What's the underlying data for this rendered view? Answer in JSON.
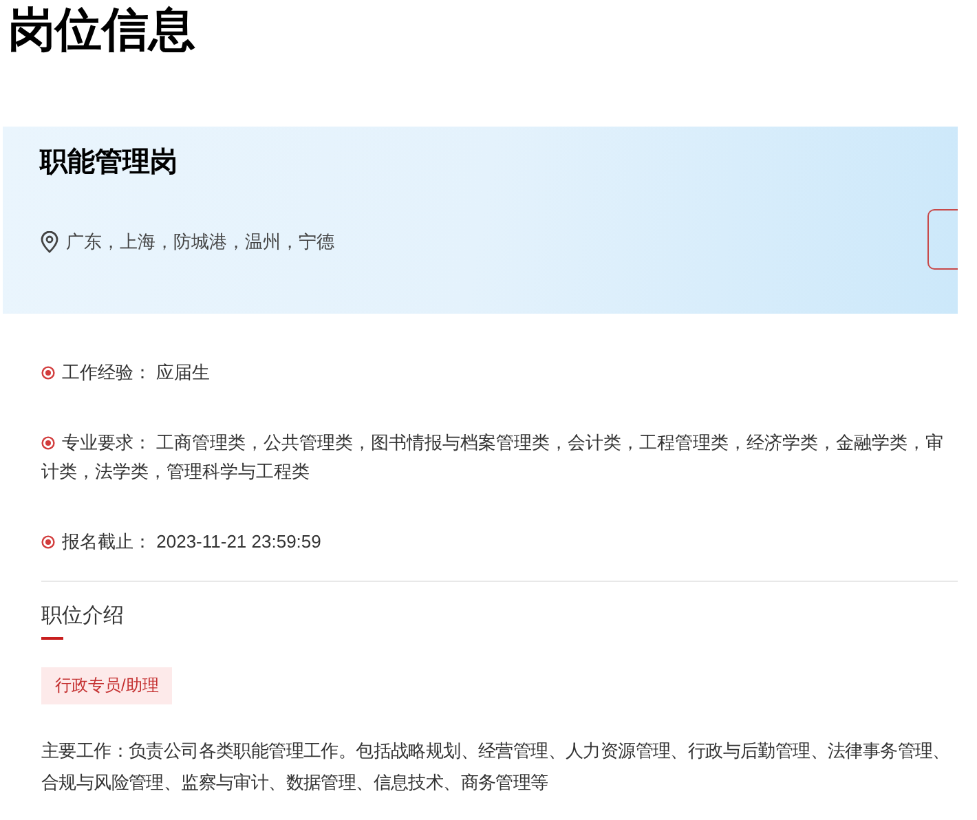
{
  "page_title": "岗位信息",
  "job": {
    "title": "职能管理岗",
    "locations": "广东，上海，防城港，温州，宁德"
  },
  "details": [
    {
      "label": "工作经验：",
      "value": "应届生"
    },
    {
      "label": "专业要求：",
      "value": "工商管理类，公共管理类，图书情报与档案管理类，会计类，工程管理类，经济学类，金融学类，审计类，法学类，管理科学与工程类"
    },
    {
      "label": "报名截止：",
      "value": "2023-11-21 23:59:59"
    }
  ],
  "intro": {
    "heading": "职位介绍",
    "tags": [
      "行政专员/助理"
    ],
    "description": "主要工作：负责公司各类职能管理工作。包括战略规划、经营管理、人力资源管理、行政与后勤管理、法律事务管理、合规与风险管理、监察与审计、数据管理、信息技术、商务管理等"
  }
}
